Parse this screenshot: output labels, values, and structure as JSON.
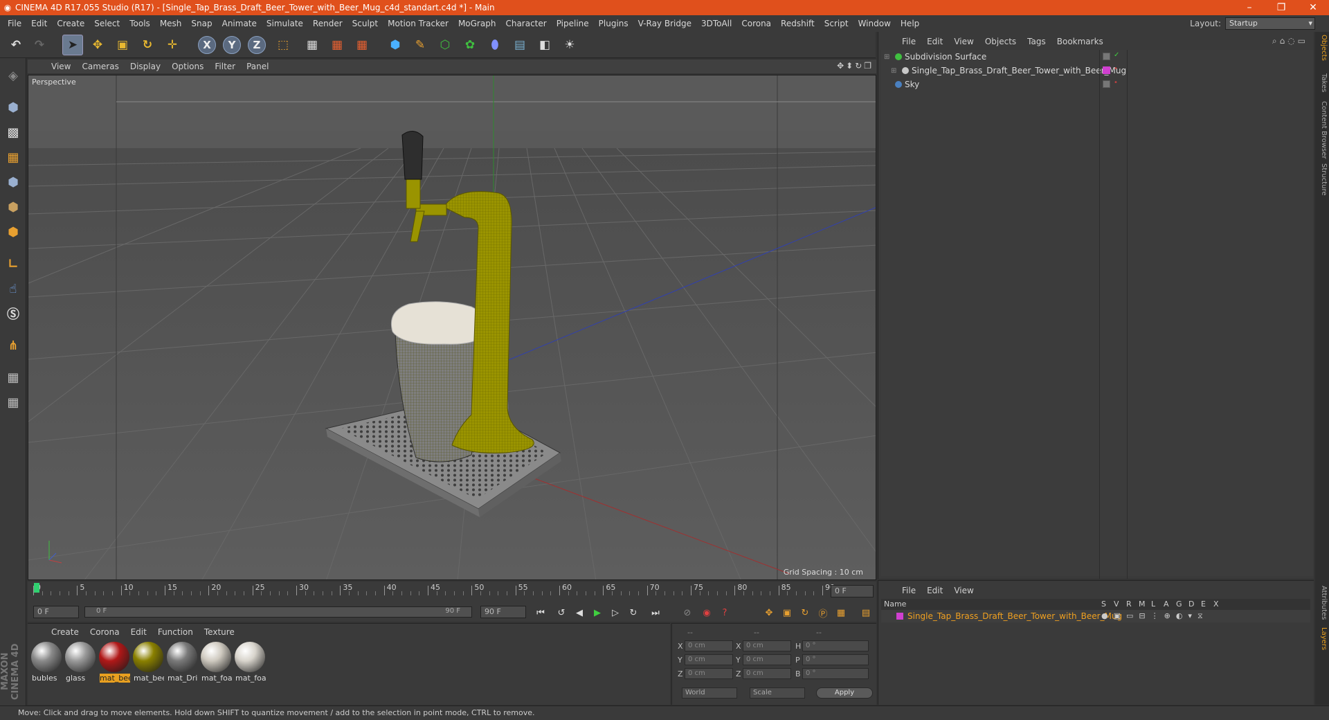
{
  "window": {
    "title": "CINEMA 4D R17.055 Studio (R17) - [Single_Tap_Brass_Draft_Beer_Tower_with_Beer_Mug_c4d_standart.c4d *] - Main",
    "controls": [
      "–",
      "❐",
      "✕"
    ]
  },
  "menubar": [
    "File",
    "Edit",
    "Create",
    "Select",
    "Tools",
    "Mesh",
    "Snap",
    "Animate",
    "Simulate",
    "Render",
    "Sculpt",
    "Motion Tracker",
    "MoGraph",
    "Character",
    "Pipeline",
    "Plugins",
    "V-Ray Bridge",
    "3DToAll",
    "Corona",
    "Redshift",
    "Script",
    "Window",
    "Help"
  ],
  "layout": {
    "label": "Layout:",
    "value": "Startup"
  },
  "viewport": {
    "menu": [
      "View",
      "Cameras",
      "Display",
      "Options",
      "Filter",
      "Panel"
    ],
    "label": "Perspective",
    "grid_spacing": "Grid Spacing : 10 cm"
  },
  "timeline": {
    "ticks": [
      "0",
      "5",
      "10",
      "15",
      "20",
      "25",
      "30",
      "35",
      "40",
      "45",
      "50",
      "55",
      "60",
      "65",
      "70",
      "75",
      "80",
      "85",
      "90"
    ],
    "current_frame": "0 F",
    "start_field": "0 F",
    "range_start": "0 F",
    "range_end": "90 F",
    "end_field": "90 F"
  },
  "material_manager": {
    "menu": [
      "Create",
      "Corona",
      "Edit",
      "Function",
      "Texture"
    ],
    "materials": [
      {
        "label": "bubles",
        "color": "#8a8a8a"
      },
      {
        "label": "glass",
        "color": "#9a9a9a"
      },
      {
        "label": "mat_bee",
        "color": "#b01818"
      },
      {
        "label": "mat_bee",
        "color": "#8a8000"
      },
      {
        "label": "mat_Dri",
        "color": "#7a7a7a"
      },
      {
        "label": "mat_foa",
        "color": "#cfcac0"
      },
      {
        "label": "mat_foa",
        "color": "#d8d4cc"
      }
    ]
  },
  "coordinates": {
    "headers": [
      "--",
      "--",
      "--"
    ],
    "rows": [
      {
        "a": "X",
        "av": "0 cm",
        "b": "X",
        "bv": "0 cm",
        "c": "H",
        "cv": "0 °"
      },
      {
        "a": "Y",
        "av": "0 cm",
        "b": "Y",
        "bv": "0 cm",
        "c": "P",
        "cv": "0 °"
      },
      {
        "a": "Z",
        "av": "0 cm",
        "b": "Z",
        "bv": "0 cm",
        "c": "B",
        "cv": "0 °"
      }
    ],
    "space": "World",
    "mode": "Scale",
    "apply": "Apply"
  },
  "object_manager": {
    "menu": [
      "File",
      "Edit",
      "View",
      "Objects",
      "Tags",
      "Bookmarks"
    ],
    "objects": [
      {
        "name": "Subdivision Surface",
        "icon_color": "#40c040"
      },
      {
        "name": "Single_Tap_Brass_Draft_Beer_Tower_with_Beer_Mug",
        "icon_color": "#c8c8c8",
        "tag_color": "#d040d0"
      },
      {
        "name": "Sky",
        "icon_color": "#4a80c0"
      }
    ]
  },
  "layer_manager": {
    "menu": [
      "File",
      "Edit",
      "View"
    ],
    "headers": {
      "name": "Name",
      "flags": [
        "S",
        "V",
        "R",
        "M",
        "L",
        "A",
        "G",
        "D",
        "E",
        "X"
      ]
    },
    "layer": {
      "name": "Single_Tap_Brass_Draft_Beer_Tower_with_Beer_Mug",
      "color": "#d040d0"
    }
  },
  "right_tabs": [
    "Objects",
    "Takes",
    "Content Browser",
    "Structure"
  ],
  "right_tabs_bottom": [
    "Attributes",
    "Layers"
  ],
  "branding": "MAXON CINEMA 4D",
  "status": "Move: Click and drag to move elements. Hold down SHIFT to quantize movement / add to the selection in point mode, CTRL to remove."
}
